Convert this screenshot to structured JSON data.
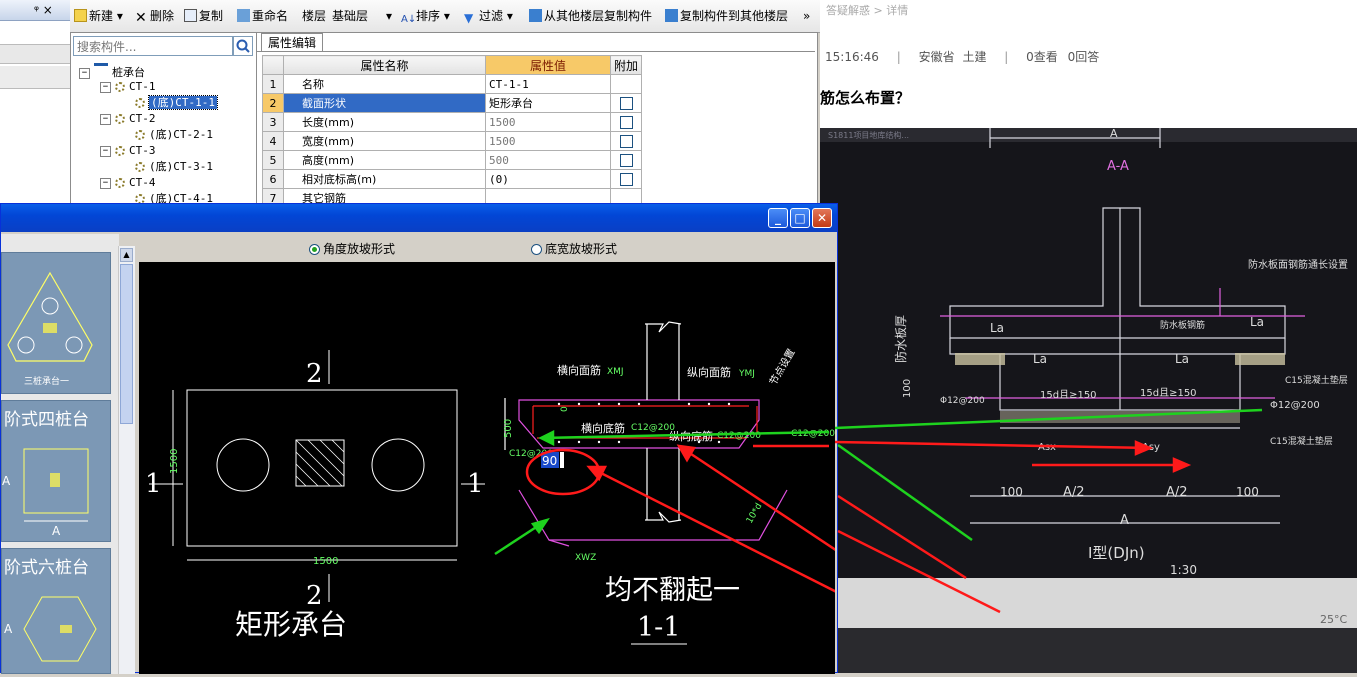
{
  "toolbar": {
    "new_label": "新建",
    "delete_label": "删除",
    "copy_label": "复制",
    "rename_label": "重命名",
    "floor_label": "楼层",
    "floor_value": "基础层",
    "sort_label": "排序",
    "filter_label": "过滤",
    "copy_from_label": "从其他楼层复制构件",
    "copy_to_label": "复制构件到其他楼层",
    "more_label": "»"
  },
  "left_strip": {
    "pin_label": "ᵠ ×"
  },
  "tree": {
    "search_placeholder": "搜索构件...",
    "root": "桩承台",
    "items": [
      {
        "group": "CT-1",
        "child": "(底)CT-1-1"
      },
      {
        "group": "CT-2",
        "child": "(底)CT-2-1"
      },
      {
        "group": "CT-3",
        "child": "(底)CT-3-1"
      },
      {
        "group": "CT-4",
        "child": "(底)CT-4-1"
      }
    ]
  },
  "properties": {
    "tab": "属性编辑",
    "headers": [
      "属性名称",
      "属性值",
      "附加"
    ],
    "rows": [
      {
        "num": "1",
        "name": "名称",
        "value": "CT-1-1",
        "check": false
      },
      {
        "num": "2",
        "name": "截面形状",
        "value": "矩形承台",
        "check": true
      },
      {
        "num": "3",
        "name": "长度(mm)",
        "value": "1500",
        "check": true
      },
      {
        "num": "4",
        "name": "宽度(mm)",
        "value": "1500",
        "check": true
      },
      {
        "num": "5",
        "name": "高度(mm)",
        "value": "500",
        "check": true
      },
      {
        "num": "6",
        "name": "相对底标高(m)",
        "value": "(0)",
        "check": true
      },
      {
        "num": "7",
        "name": "其它钢筋",
        "value": "",
        "check": false
      }
    ]
  },
  "dialog": {
    "radio_angle": "角度放坡形式",
    "radio_width": "底宽放坡形式",
    "thumb1_caption": "三桩承台一",
    "thumb2_title": "阶式四桩台",
    "thumb3_title": "阶式六桩台",
    "thumb_letter": "A"
  },
  "drawing": {
    "plan_dim": "1500",
    "section_num_top": "2",
    "section_num_bottom": "2",
    "side_label": "1",
    "plan_caption": "矩形承台",
    "top_bar_label": "横向面筋",
    "top_bar_code": "XMJ",
    "long_bar_label": "纵向面筋",
    "long_bar_code": "YMJ",
    "bottom_bar_label": "横向底筋",
    "bottom_bar_code": "C12@200",
    "long_bottom_label": "纵向底筋",
    "long_bottom_code": "C12@200",
    "left_code": "C12@200",
    "right_code": "C12@200",
    "height_dim": "500",
    "angle_value": "90",
    "node_label": "节点设置",
    "zero_label": "0",
    "dim_tag": "10*d",
    "xwz_tag": "XWZ",
    "annotation": "均不翻起一",
    "section_caption": "1-1"
  },
  "web": {
    "breadcrumb": "答疑解惑 > 详情",
    "time": "15:16:46",
    "sep": "|",
    "region": "安徽省",
    "category": "土建",
    "views": "0查看",
    "answers": "0回答",
    "question": "筋怎么布置？"
  },
  "photo": {
    "top_label": "A",
    "section": "A-A",
    "la": "La",
    "waterproof": "防水板厚",
    "h100": "100",
    "rebar1": "防水板面钢筋通长设置",
    "rebar2": "防水板钢筋",
    "rebar3": "Φ12@200",
    "rebar4": "Φ12@200",
    "c15": "C15混凝土垫层",
    "c15b": "C15混凝土垫层",
    "anchor": "15d且≥150",
    "asx": "Asx",
    "asy": "Asy",
    "dim100": "100",
    "dimA2": "A/2",
    "dimA": "A",
    "type": "I型(DJn)",
    "scale": "1:30",
    "tab_text": "S1811项目地库结构...",
    "temp": "25°C"
  },
  "colors": {
    "titlebar": "#0a4ede",
    "canvas": "#000000",
    "thumb": "#7c98b5",
    "annotation_red": "#ff1a1a",
    "annotation_green": "#1ed21e",
    "highlight": "#f7c968"
  }
}
